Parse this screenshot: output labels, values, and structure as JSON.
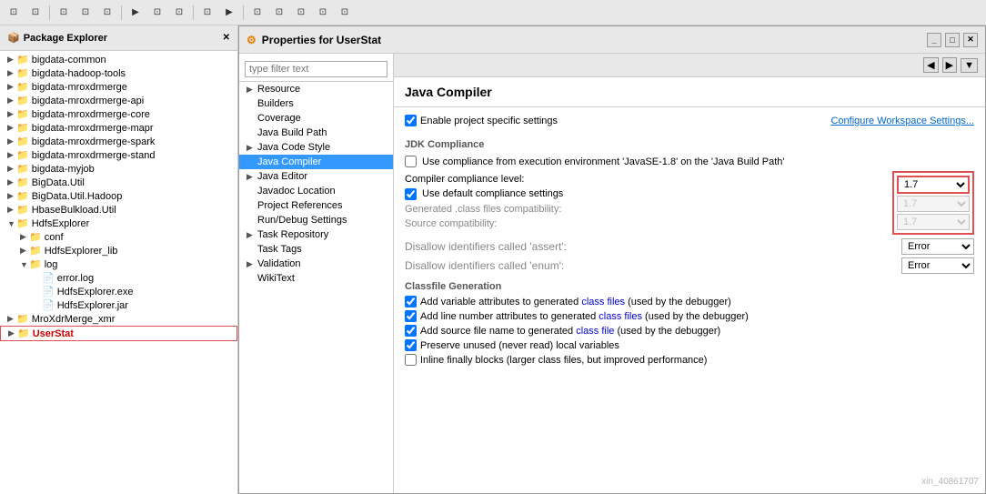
{
  "toolbar": {
    "buttons": [
      "◀",
      "▶",
      "⬛",
      "⬛",
      "⬛",
      "⬛",
      "⬛",
      "⬛",
      "⬛",
      "⬛",
      "⬛",
      "⬛",
      "⬛",
      "▶",
      "⬛",
      "⬛"
    ]
  },
  "packageExplorer": {
    "title": "Package Explorer",
    "items": [
      {
        "label": "bigdata-common",
        "indent": 1,
        "type": "folder"
      },
      {
        "label": "bigdata-hadoop-tools",
        "indent": 1,
        "type": "folder"
      },
      {
        "label": "bigdata-mroxdrmerge",
        "indent": 1,
        "type": "folder"
      },
      {
        "label": "bigdata-mroxdrmerge-api",
        "indent": 1,
        "type": "folder"
      },
      {
        "label": "bigdata-mroxdrmerge-core",
        "indent": 1,
        "type": "folder"
      },
      {
        "label": "bigdata-mroxdrmerge-mapr",
        "indent": 1,
        "type": "folder"
      },
      {
        "label": "bigdata-mroxdrmerge-spark",
        "indent": 1,
        "type": "folder"
      },
      {
        "label": "bigdata-mroxdrmerge-stand",
        "indent": 1,
        "type": "folder"
      },
      {
        "label": "bigdata-myjob",
        "indent": 1,
        "type": "folder"
      },
      {
        "label": "BigData.Util",
        "indent": 1,
        "type": "folder"
      },
      {
        "label": "BigData.Util.Hadoop",
        "indent": 1,
        "type": "folder"
      },
      {
        "label": "HbaseBulkload.Util",
        "indent": 1,
        "type": "folder"
      },
      {
        "label": "HdfsExplorer",
        "indent": 1,
        "type": "folder",
        "expanded": true
      },
      {
        "label": "conf",
        "indent": 2,
        "type": "folder"
      },
      {
        "label": "HdfsExplorer_lib",
        "indent": 2,
        "type": "folder"
      },
      {
        "label": "log",
        "indent": 2,
        "type": "folder",
        "expanded": true
      },
      {
        "label": "error.log",
        "indent": 3,
        "type": "file"
      },
      {
        "label": "HdfsExplorer.exe",
        "indent": 3,
        "type": "file"
      },
      {
        "label": "HdfsExplorer.jar",
        "indent": 3,
        "type": "file"
      },
      {
        "label": "MroXdrMerge_xmr",
        "indent": 1,
        "type": "folder"
      },
      {
        "label": "UserStat",
        "indent": 1,
        "type": "folder",
        "selected": true
      }
    ]
  },
  "dialog": {
    "title": "Properties for UserStat",
    "filterPlaceholder": "type filter text",
    "navItems": [
      {
        "label": "Resource",
        "indent": 0,
        "hasArrow": true
      },
      {
        "label": "Builders",
        "indent": 0,
        "hasArrow": false
      },
      {
        "label": "Coverage",
        "indent": 0,
        "hasArrow": false
      },
      {
        "label": "Java Build Path",
        "indent": 0,
        "hasArrow": false
      },
      {
        "label": "Java Code Style",
        "indent": 0,
        "hasArrow": true
      },
      {
        "label": "Java Compiler",
        "indent": 0,
        "hasArrow": false,
        "active": true
      },
      {
        "label": "Java Editor",
        "indent": 0,
        "hasArrow": true
      },
      {
        "label": "Javadoc Location",
        "indent": 0,
        "hasArrow": false
      },
      {
        "label": "Project References",
        "indent": 0,
        "hasArrow": false
      },
      {
        "label": "Run/Debug Settings",
        "indent": 0,
        "hasArrow": false
      },
      {
        "label": "Task Repository",
        "indent": 0,
        "hasArrow": true
      },
      {
        "label": "Task Tags",
        "indent": 0,
        "hasArrow": false
      },
      {
        "label": "Validation",
        "indent": 0,
        "hasArrow": true
      },
      {
        "label": "WikiText",
        "indent": 0,
        "hasArrow": false
      }
    ]
  },
  "javaCompiler": {
    "pageTitle": "Java Compiler",
    "enableProjectSpecificLabel": "Enable project specific settings",
    "configureWorkspaceLink": "Configure Workspace Settings...",
    "jdkSection": {
      "title": "JDK Compliance",
      "useComplianceLabel": "Use compliance from execution environment 'JavaSE-1.8' on the ",
      "javaBuiltPathLink": "'Java Build Path'",
      "compilerComplianceLevelLabel": "Compiler compliance level:",
      "compilerComplianceValue": "1.7",
      "useDefaultComplianceLabel": "Use default compliance settings",
      "generatedClassFilesLabel": "Generated .class files compatibility:",
      "generatedClassFilesValue": "1.7",
      "sourceCompatibilityLabel": "Source compatibility:",
      "sourceCompatibilityValue": "1.7",
      "disallowAssertLabel": "Disallow identifiers called 'assert':",
      "disallowAssertValue": "Error",
      "disallowEnumLabel": "Disallow identifiers called 'enum':",
      "disallowEnumValue": "Error"
    },
    "classfileSection": {
      "title": "Classfile Generation",
      "items": [
        {
          "label": "Add variable attributes to generated ",
          "highlight": "class files",
          "suffix": " (used by the debugger)",
          "checked": true
        },
        {
          "label": "Add line number attributes to generated ",
          "highlight": "class files",
          "suffix": " (used by the debugger)",
          "checked": true
        },
        {
          "label": "Add source file name to generated ",
          "highlight": "class file",
          "suffix": " (used by the debugger)",
          "checked": true
        },
        {
          "label": "Preserve unused (never read) local variables",
          "highlight": "",
          "suffix": "",
          "checked": true
        },
        {
          "label": "Inline finally blocks (larger class files, but improved performance)",
          "highlight": "",
          "suffix": "",
          "checked": false,
          "partial": true
        }
      ]
    }
  },
  "watermark": "xin_40861707"
}
